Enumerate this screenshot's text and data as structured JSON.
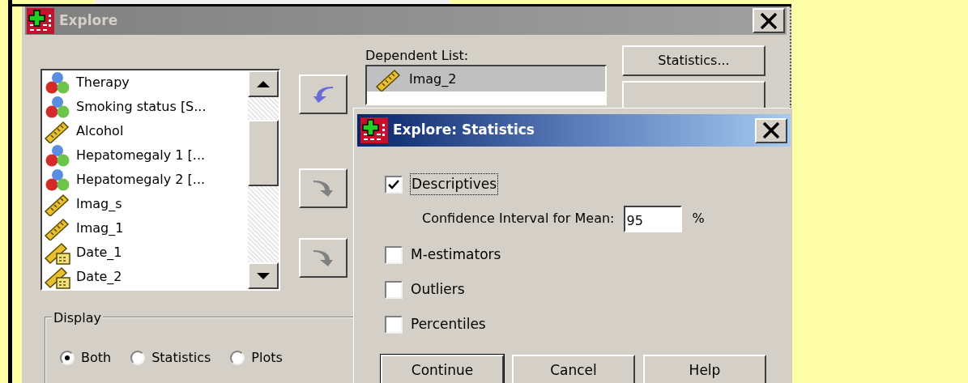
{
  "explore_window": {
    "title": "Explore",
    "active": false,
    "variables": [
      {
        "label": "Therapy",
        "kind": "nominal"
      },
      {
        "label": "Smoking status [S...",
        "kind": "nominal"
      },
      {
        "label": "Alcohol",
        "kind": "scale"
      },
      {
        "label": "Hepatomegaly 1 [...",
        "kind": "nominal"
      },
      {
        "label": "Hepatomegaly 2 [...",
        "kind": "nominal"
      },
      {
        "label": "Imag_s",
        "kind": "scale"
      },
      {
        "label": "Imag_1",
        "kind": "scale"
      },
      {
        "label": "Date_1",
        "kind": "date"
      },
      {
        "label": "Date_2",
        "kind": "date"
      }
    ],
    "move_buttons": [
      {
        "kind": "back",
        "disabled": false
      },
      {
        "kind": "forward",
        "disabled": true
      },
      {
        "kind": "forward",
        "disabled": true
      }
    ],
    "dependent_list": {
      "label": "Dependent List:",
      "items": [
        {
          "label": "Imag_2",
          "kind": "scale",
          "selected": true
        }
      ]
    },
    "side_buttons": [
      "Statistics..."
    ],
    "display": {
      "label": "Display",
      "options": [
        {
          "label": "Both",
          "selected": true
        },
        {
          "label": "Statistics",
          "selected": false
        },
        {
          "label": "Plots",
          "selected": false
        }
      ]
    }
  },
  "statistics_dialog": {
    "title": "Explore: Statistics",
    "active": true,
    "options": [
      {
        "label": "Descriptives",
        "checked": true,
        "focused": true
      },
      {
        "kind": "field",
        "label": "Confidence Interval for Mean:",
        "value": "95",
        "unit": "%"
      },
      {
        "label": "M-estimators",
        "checked": false,
        "focused": false
      },
      {
        "label": "Outliers",
        "checked": false,
        "focused": false
      },
      {
        "label": "Percentiles",
        "checked": false,
        "focused": false
      }
    ],
    "buttons": [
      "Continue",
      "Cancel",
      "Help"
    ]
  }
}
